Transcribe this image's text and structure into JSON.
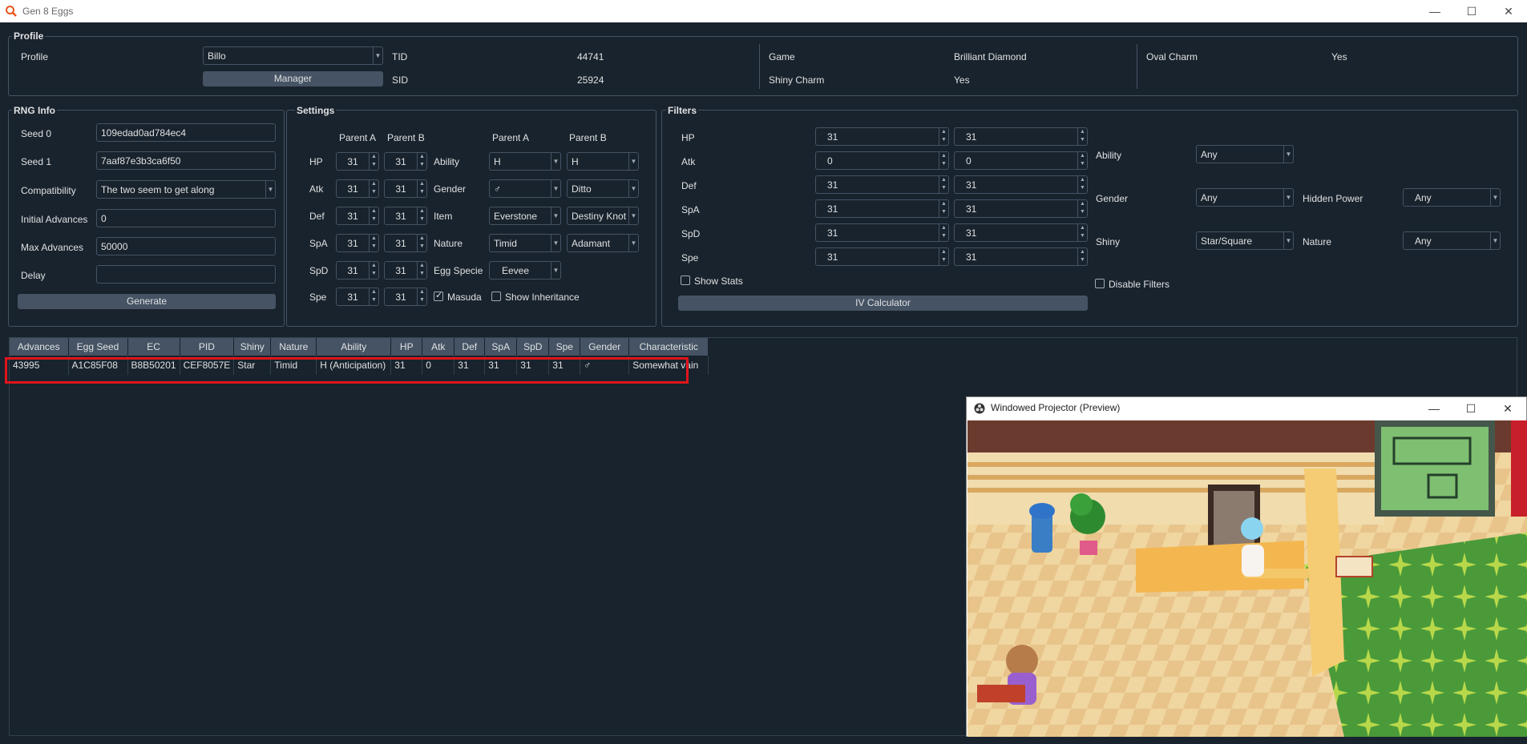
{
  "window": {
    "title": "Gen 8 Eggs",
    "minimize": "—",
    "maximize": "☐",
    "close": "✕"
  },
  "profile": {
    "group_title": "Profile",
    "profile_label": "Profile",
    "profile_value": "Billo",
    "manager_button": "Manager",
    "tid_label": "TID",
    "tid_value": "44741",
    "sid_label": "SID",
    "sid_value": "25924",
    "game_label": "Game",
    "game_value": "Brilliant Diamond",
    "shiny_charm_label": "Shiny Charm",
    "shiny_charm_value": "Yes",
    "oval_charm_label": "Oval Charm",
    "oval_charm_value": "Yes"
  },
  "rng": {
    "group_title": "RNG Info",
    "seed0_label": "Seed 0",
    "seed0_value": "109edad0ad784ec4",
    "seed1_label": "Seed 1",
    "seed1_value": "7aaf87e3b3ca6f50",
    "compat_label": "Compatibility",
    "compat_value": "The two seem to get along",
    "initial_label": "Initial Advances",
    "initial_value": "0",
    "max_label": "Max Advances",
    "max_value": "50000",
    "delay_label": "Delay",
    "delay_value": "",
    "generate_button": "Generate"
  },
  "settings": {
    "group_title": "Settings",
    "parent_a": "Parent A",
    "parent_b": "Parent B",
    "iv_rows": [
      {
        "label": "HP",
        "a": "31",
        "b": "31"
      },
      {
        "label": "Atk",
        "a": "31",
        "b": "31"
      },
      {
        "label": "Def",
        "a": "31",
        "b": "31"
      },
      {
        "label": "SpA",
        "a": "31",
        "b": "31"
      },
      {
        "label": "SpD",
        "a": "31",
        "b": "31"
      },
      {
        "label": "Spe",
        "a": "31",
        "b": "31"
      }
    ],
    "ability_label": "Ability",
    "ability_a": "H",
    "ability_b": "H",
    "gender_label": "Gender",
    "gender_a": "♂",
    "gender_b": "Ditto",
    "item_label": "Item",
    "item_a": "Everstone",
    "item_b": "Destiny Knot",
    "nature_label": "Nature",
    "nature_a": "Timid",
    "nature_b": "Adamant",
    "egg_specie_label": "Egg Specie",
    "egg_specie_value": "Eevee",
    "masuda_label": "Masuda",
    "show_inheritance_label": "Show Inheritance"
  },
  "filters": {
    "group_title": "Filters",
    "iv_rows": [
      {
        "label": "HP",
        "min": "31",
        "max": "31"
      },
      {
        "label": "Atk",
        "min": "0",
        "max": "0"
      },
      {
        "label": "Def",
        "min": "31",
        "max": "31"
      },
      {
        "label": "SpA",
        "min": "31",
        "max": "31"
      },
      {
        "label": "SpD",
        "min": "31",
        "max": "31"
      },
      {
        "label": "Spe",
        "min": "31",
        "max": "31"
      }
    ],
    "show_stats_label": "Show Stats",
    "iv_calc_button": "IV Calculator",
    "ability_label": "Ability",
    "ability_value": "Any",
    "gender_label": "Gender",
    "gender_value": "Any",
    "hidden_power_label": "Hidden Power",
    "hidden_power_value": "Any",
    "shiny_label": "Shiny",
    "shiny_value": "Star/Square",
    "nature_label": "Nature",
    "nature_value": "Any",
    "disable_filters_label": "Disable Filters"
  },
  "results": {
    "columns": [
      "Advances",
      "Egg Seed",
      "EC",
      "PID",
      "Shiny",
      "Nature",
      "Ability",
      "HP",
      "Atk",
      "Def",
      "SpA",
      "SpD",
      "Spe",
      "Gender",
      "Characteristic"
    ],
    "rows": [
      [
        "43995",
        "A1C85F08",
        "B8B50201",
        "CEF8057E",
        "Star",
        "Timid",
        "H (Anticipation)",
        "31",
        "0",
        "31",
        "31",
        "31",
        "31",
        "♂",
        "Somewhat vain"
      ]
    ]
  },
  "projector": {
    "title": "Windowed Projector (Preview)",
    "minimize": "—",
    "maximize": "☐",
    "close": "✕"
  },
  "colors": {
    "background": "#19232d",
    "border": "#455364",
    "highlight": "#e0151b"
  }
}
